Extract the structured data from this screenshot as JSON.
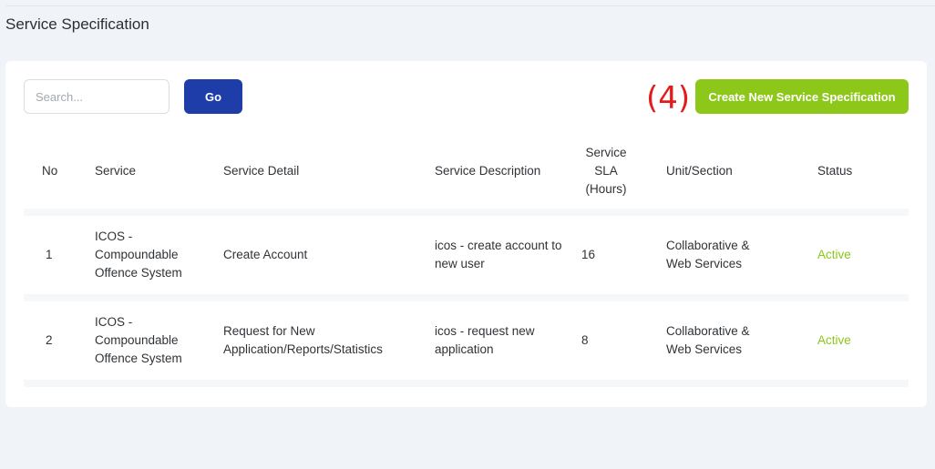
{
  "page": {
    "title": "Service Specification"
  },
  "toolbar": {
    "search_placeholder": "Search...",
    "go_label": "Go",
    "annotation": "(4)",
    "create_label": "Create New Service Specification"
  },
  "table": {
    "headers": {
      "no": "No",
      "service": "Service",
      "detail": "Service Detail",
      "description": "Service Description",
      "sla": "Service SLA (Hours)",
      "unit": "Unit/Section",
      "status": "Status"
    },
    "rows": [
      {
        "no": "1",
        "service": "ICOS - Compoundable Offence System",
        "detail": "Create Account",
        "description": "icos - create account to new user",
        "sla": "16",
        "unit": "Collaborative & Web Services",
        "status": "Active"
      },
      {
        "no": "2",
        "service": "ICOS - Compoundable Offence System",
        "detail": "Request for New Application/Reports/Statistics",
        "description": "icos - request new application",
        "sla": "8",
        "unit": "Collaborative & Web Services",
        "status": "Active"
      }
    ]
  },
  "colors": {
    "primary": "#1e3da8",
    "success": "#8cc71a",
    "annotation": "#e31b1b"
  }
}
